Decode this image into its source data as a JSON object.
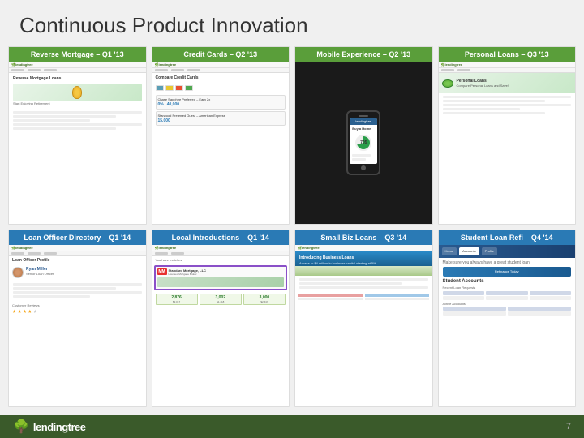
{
  "slide": {
    "title": "Continuous Product Innovation",
    "page_number": "7"
  },
  "cards": [
    {
      "id": "reverse-mortgage",
      "header": "Reverse Mortgage – Q1 '13",
      "header_color": "green",
      "type": "reverse-mortgage"
    },
    {
      "id": "credit-cards",
      "header": "Credit Cards – Q2 '13",
      "header_color": "green",
      "type": "credit-cards"
    },
    {
      "id": "mobile-experience",
      "header": "Mobile Experience – Q2 '13",
      "header_color": "green",
      "type": "mobile"
    },
    {
      "id": "personal-loans",
      "header": "Personal Loans – Q3 '13",
      "header_color": "green",
      "type": "personal-loans"
    },
    {
      "id": "loan-officer",
      "header": "Loan Officer Directory – Q1 '14",
      "header_color": "blue",
      "type": "loan-officer"
    },
    {
      "id": "local-introductions",
      "header": "Local Introductions – Q1 '14",
      "header_color": "blue",
      "type": "local-introductions"
    },
    {
      "id": "small-biz",
      "header": "Small Biz Loans – Q3 '14",
      "header_color": "blue",
      "type": "small-biz"
    },
    {
      "id": "student-loan",
      "header": "Student Loan Refi – Q4 '14",
      "header_color": "blue",
      "type": "student-loan"
    }
  ],
  "bottom_bar": {
    "logo_text": "lendingtree",
    "page_number": "7"
  }
}
